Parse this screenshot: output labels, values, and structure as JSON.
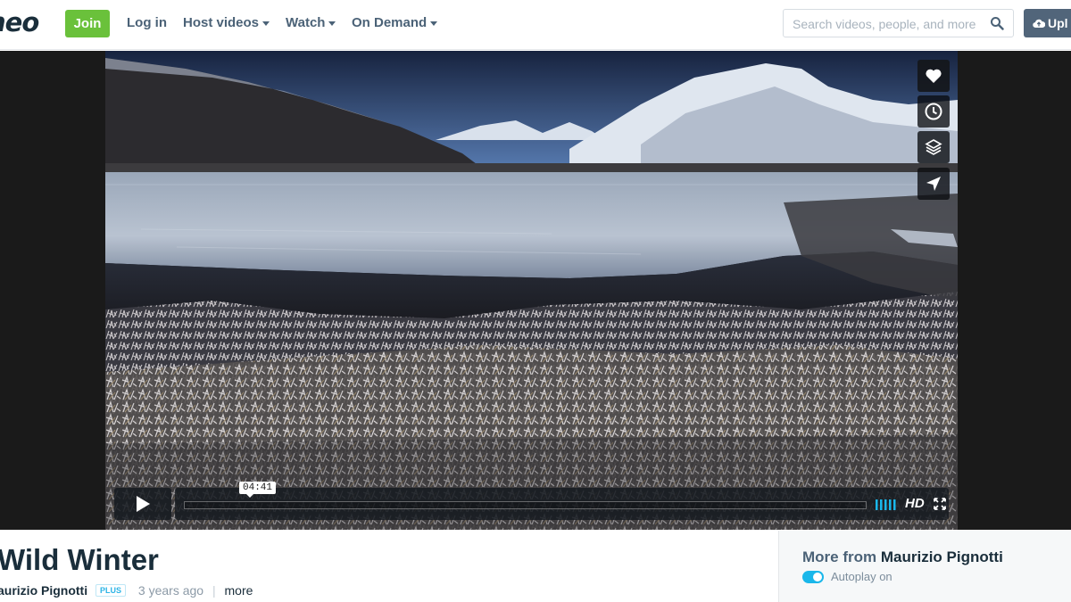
{
  "header": {
    "logo_text": "neo",
    "join_label": "Join",
    "login_label": "Log in",
    "nav": [
      {
        "label": "Host videos"
      },
      {
        "label": "Watch"
      },
      {
        "label": "On Demand"
      }
    ],
    "search_placeholder": "Search videos, people, and more",
    "upload_label": "Upl"
  },
  "player": {
    "time_display": "04:41",
    "progress_fraction": 0.0,
    "hd_label": "HD",
    "side_actions": [
      "heart-icon",
      "clock-icon",
      "layers-icon",
      "paper-plane-icon"
    ]
  },
  "video": {
    "title": "Wild Winter",
    "author": "aurizio Pignotti",
    "badge": "PLUS",
    "posted": "3 years ago",
    "more_link": "more"
  },
  "sidebar": {
    "more_from_prefix": "More from",
    "more_from_author": "Maurizio Pignotti",
    "autoplay_label": "Autoplay on"
  },
  "colors": {
    "join_green": "#6ac13b",
    "nav_text": "#4b6277",
    "title_text": "#1a2e3b",
    "toggle_blue": "#1ab7ea",
    "plus_blue": "#2bb4e6"
  }
}
